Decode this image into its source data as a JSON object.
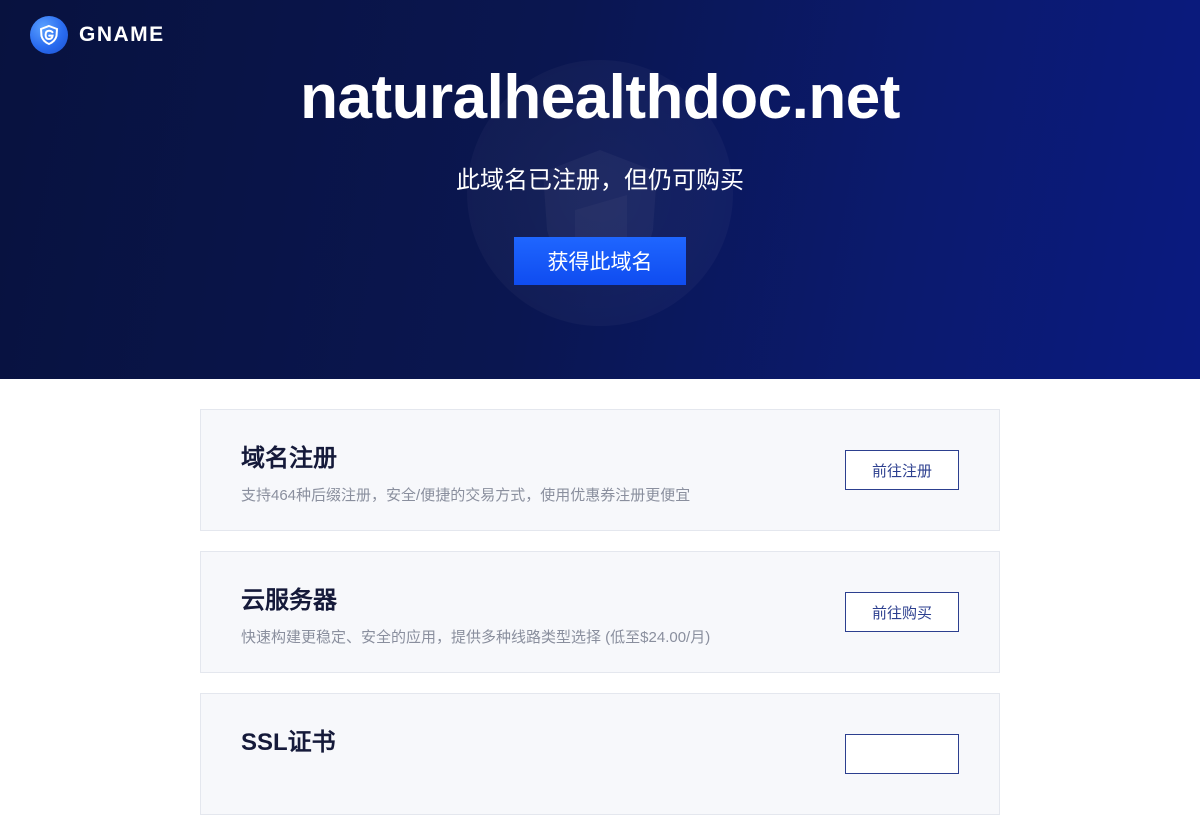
{
  "brand": {
    "name": "GNAME"
  },
  "hero": {
    "domain": "naturalhealthdoc.net",
    "subtitle": "此域名已注册，但仍可购买",
    "cta_label": "获得此域名"
  },
  "services": [
    {
      "title": "域名注册",
      "description": "支持464种后缀注册，安全/便捷的交易方式，使用优惠券注册更便宜",
      "button": "前往注册"
    },
    {
      "title": "云服务器",
      "description": "快速构建更稳定、安全的应用，提供多种线路类型选择 (低至$24.00/月)",
      "button": "前往购买"
    },
    {
      "title": "SSL证书",
      "description": "",
      "button": ""
    }
  ],
  "colors": {
    "hero_bg": "#0a1650",
    "accent": "#1f66ff",
    "card_bg": "#f7f8fb",
    "outline_button": "#2c3f8f"
  },
  "icons": {
    "logo": "gname-g-icon",
    "watermark": "shield-watermark-icon"
  }
}
